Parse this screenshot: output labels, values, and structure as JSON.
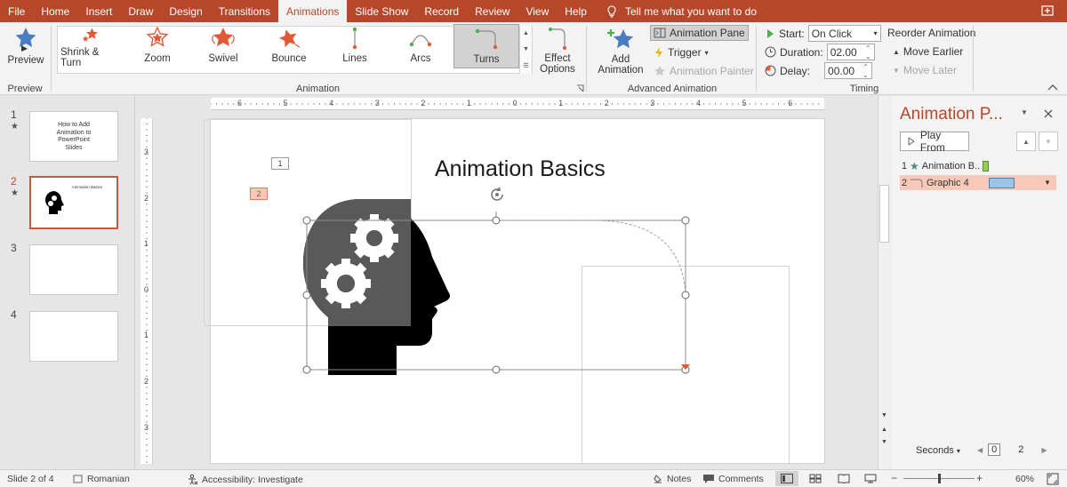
{
  "tabs": [
    "File",
    "Home",
    "Insert",
    "Draw",
    "Design",
    "Transitions",
    "Animations",
    "Slide Show",
    "Record",
    "Review",
    "View",
    "Help"
  ],
  "active_tab": "Animations",
  "tell_me": "Tell me what you want to do",
  "ribbon": {
    "preview": {
      "label": "Preview",
      "group": "Preview"
    },
    "animation_group": "Animation",
    "gallery": [
      {
        "label": "Shrink & Turn",
        "icon": "shrink-turn-star-icon"
      },
      {
        "label": "Zoom",
        "icon": "zoom-star-icon"
      },
      {
        "label": "Swivel",
        "icon": "swivel-star-icon"
      },
      {
        "label": "Bounce",
        "icon": "bounce-star-icon"
      },
      {
        "label": "Lines",
        "icon": "lines-path-icon"
      },
      {
        "label": "Arcs",
        "icon": "arcs-path-icon"
      },
      {
        "label": "Turns",
        "icon": "turns-path-icon"
      }
    ],
    "gallery_selected": "Turns",
    "effect_options": {
      "line1": "Effect",
      "line2": "Options"
    },
    "advanced_group": "Advanced Animation",
    "add_animation": {
      "line1": "Add",
      "line2": "Animation"
    },
    "animation_pane": "Animation Pane",
    "trigger": "Trigger",
    "animation_painter": "Animation Painter",
    "timing_group": "Timing",
    "start_label": "Start:",
    "start_value": "On Click",
    "duration_label": "Duration:",
    "duration_value": "02.00",
    "delay_label": "Delay:",
    "delay_value": "00.00",
    "reorder": "Reorder Animation",
    "move_earlier": "Move Earlier",
    "move_later": "Move Later"
  },
  "slides": [
    {
      "num": "1",
      "star": "★",
      "text": "How to Add Animation to PowerPoint Slides"
    },
    {
      "num": "2",
      "star": "★",
      "text": "Animation Basics"
    },
    {
      "num": "3",
      "star": "",
      "text": ""
    },
    {
      "num": "4",
      "star": "",
      "text": ""
    }
  ],
  "active_slide": "2",
  "slide": {
    "title": "Animation Basics",
    "tag1": "1",
    "tag2": "2"
  },
  "hruler_labels": [
    "6",
    "5",
    "4",
    "3",
    "2",
    "1",
    "0",
    "1",
    "2",
    "3",
    "4",
    "5",
    "6"
  ],
  "vruler_labels": [
    "3",
    "2",
    "1",
    "0",
    "1",
    "2",
    "3"
  ],
  "animation_pane": {
    "title": "Animation P...",
    "play_from": "Play From",
    "items": [
      {
        "num": "1",
        "label": "Animation B...",
        "bar_color": "#92d050"
      },
      {
        "num": "2",
        "label": "Graphic 4",
        "bar_color": "#9dc3e6"
      }
    ],
    "seconds": "Seconds",
    "timeline": [
      "0",
      "2"
    ]
  },
  "status": {
    "slide": "Slide 2 of 4",
    "language": "Romanian",
    "accessibility": "Accessibility: Investigate",
    "notes": "Notes",
    "comments": "Comments",
    "zoom": "60%"
  },
  "colors": {
    "accent": "#b7472a",
    "selected_row": "#f8c9b8"
  }
}
